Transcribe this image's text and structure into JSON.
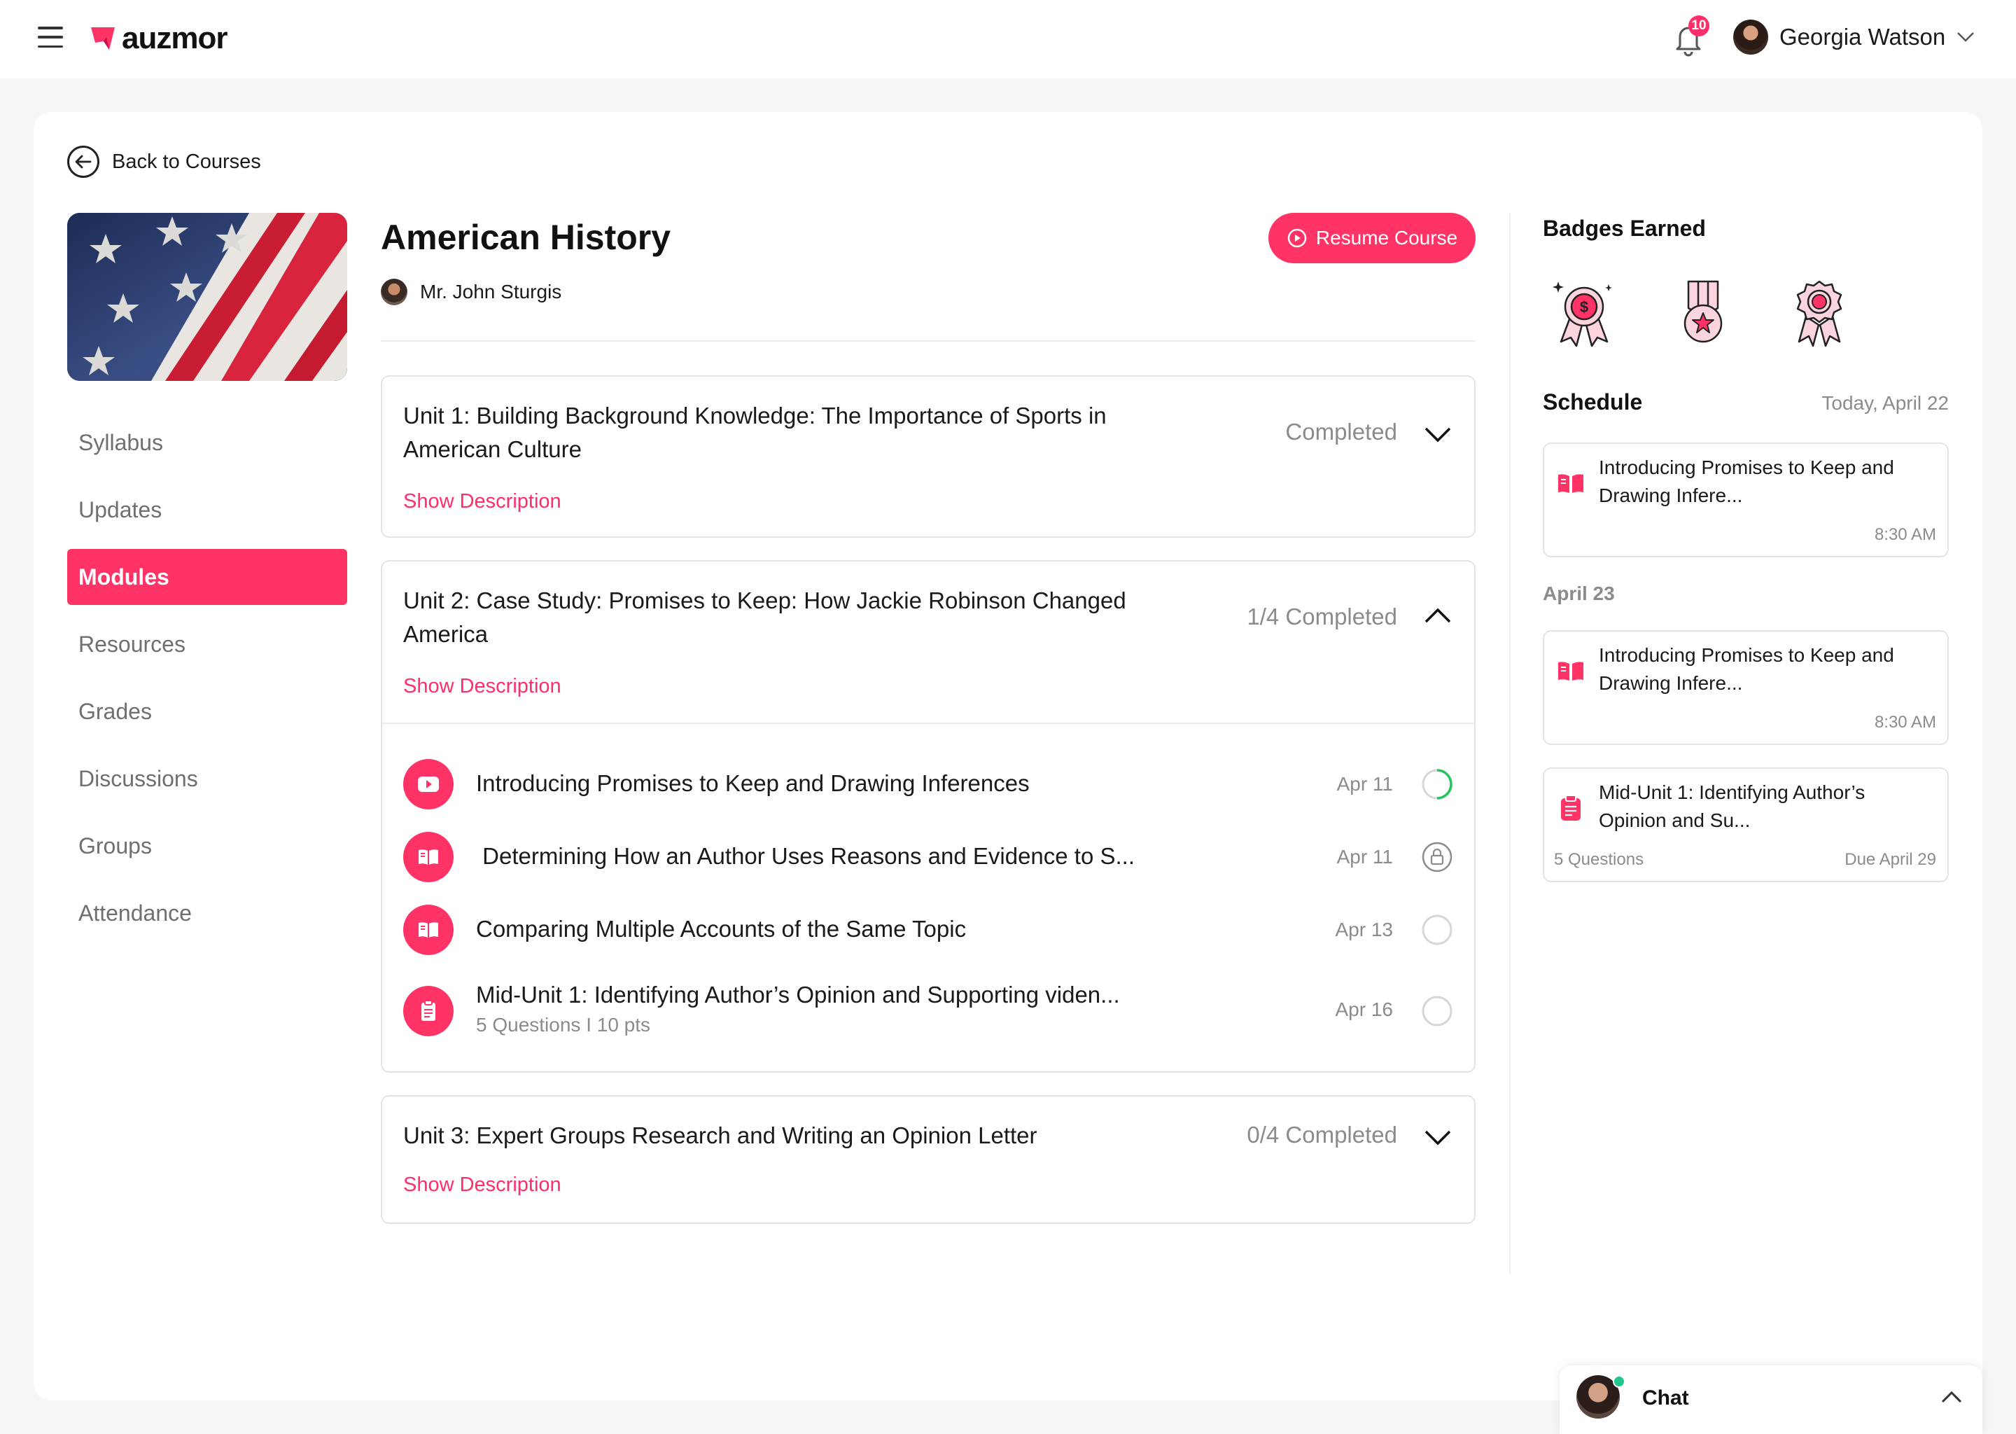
{
  "header": {
    "brand": "auzmor",
    "notification_count": "10",
    "user_name": "Georgia Watson"
  },
  "back_label": "Back to Courses",
  "sidebar": {
    "items": [
      {
        "label": "Syllabus"
      },
      {
        "label": "Updates"
      },
      {
        "label": "Modules",
        "active": true
      },
      {
        "label": "Resources"
      },
      {
        "label": "Grades"
      },
      {
        "label": "Discussions"
      },
      {
        "label": "Groups"
      },
      {
        "label": "Attendance"
      }
    ]
  },
  "course": {
    "title": "American History",
    "instructor": "Mr. John Sturgis",
    "resume_label": "Resume Course"
  },
  "units": [
    {
      "title": "Unit 1: Building Background Knowledge: The Importance of Sports in American Culture",
      "status": "Completed",
      "show_description": "Show Description",
      "expanded": false
    },
    {
      "title": "Unit 2: Case Study: Promises to Keep: How Jackie Robinson Changed America",
      "status": "1/4 Completed",
      "show_description": "Show Description",
      "expanded": true,
      "lessons": [
        {
          "title": "Introducing Promises to Keep and Drawing Inferences",
          "date": "Apr 11",
          "icon": "play-icon",
          "state": "in-progress"
        },
        {
          "title": " Determining How an Author Uses Reasons and Evidence to S...",
          "date": "Apr 11",
          "icon": "book-icon",
          "state": "locked"
        },
        {
          "title": "Comparing Multiple Accounts of the Same Topic",
          "date": "Apr 13",
          "icon": "book-icon",
          "state": "not-started"
        },
        {
          "title": "Mid-Unit 1: Identifying Author’s Opinion and Supporting viden...",
          "subtitle": "5 Questions I 10 pts",
          "date": "Apr 16",
          "icon": "quiz-icon",
          "state": "not-started"
        }
      ]
    },
    {
      "title": "Unit 3: Expert Groups Research and Writing an Opinion Letter",
      "status": "0/4 Completed",
      "show_description": "Show Description",
      "expanded": false
    }
  ],
  "badges": {
    "heading": "Badges Earned",
    "items": [
      "dollar-medal-icon",
      "star-medal-icon",
      "rosette-icon"
    ]
  },
  "schedule": {
    "heading": "Schedule",
    "today_label": "Today, April 22",
    "second_day_label": "April 23",
    "cards": [
      {
        "title": "Introducing Promises to Keep and Drawing Infere...",
        "time": "8:30 AM"
      },
      {
        "title": "Introducing Promises to Keep and Drawing Infere...",
        "time": "8:30 AM"
      },
      {
        "title": "Mid-Unit 1: Identifying Author’s Opinion and Su...",
        "meta": "5 Questions",
        "due": "Due April 29"
      }
    ]
  },
  "chat": {
    "label": "Chat"
  },
  "colors": {
    "accent": "#ff3366",
    "link": "#ff2e6a",
    "muted": "#8b8b8b",
    "online": "#22c58b",
    "progress": "#22c55e"
  }
}
